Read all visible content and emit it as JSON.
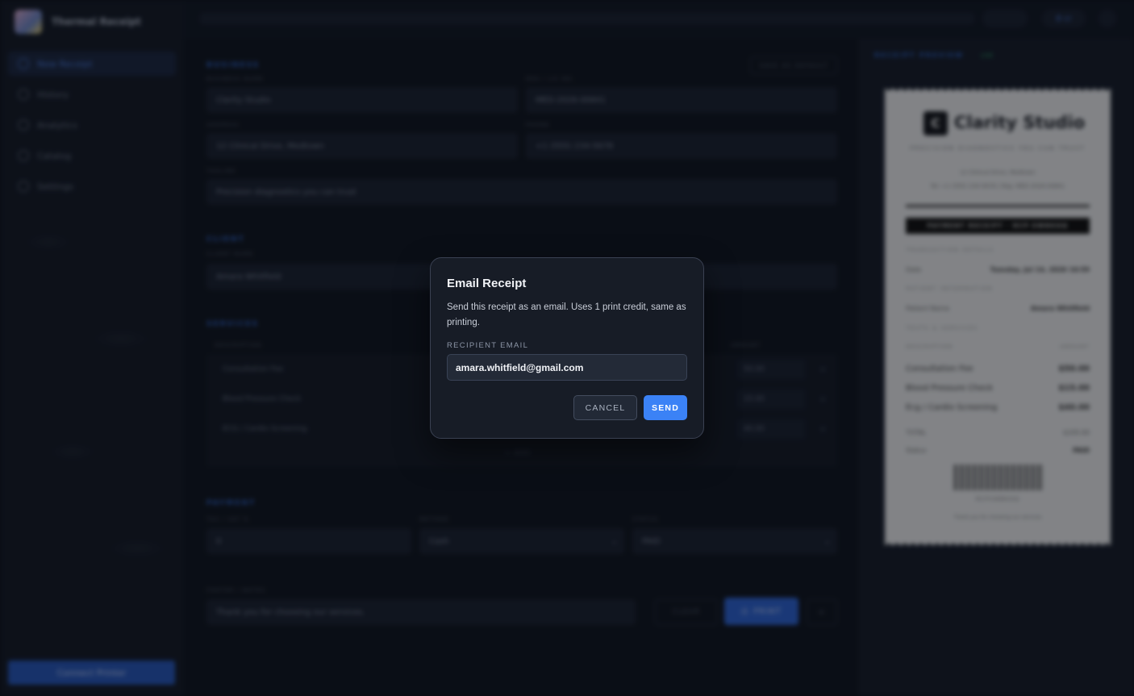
{
  "app": {
    "title": "Thermal Receipt"
  },
  "sidebar": {
    "items": [
      {
        "label": "New Receipt"
      },
      {
        "label": "History"
      },
      {
        "label": "Analytics"
      },
      {
        "label": "Catalog"
      },
      {
        "label": "Settings"
      }
    ],
    "connect_label": "Connect Printer"
  },
  "topbar": {
    "credits": "8 cr"
  },
  "form": {
    "business": {
      "title": "BUSINESS",
      "save_default_label": "SAVE AS DEFAULT",
      "name_label": "BUSINESS NAME",
      "name": "Clarity Studio",
      "reg_label": "REG / LIC NO.",
      "reg": "MED-2026-00841",
      "address_label": "ADDRESS",
      "address": "12 Clinical Drive, Medtown",
      "phone_label": "PHONE",
      "phone": "+1 (555) 234-5678",
      "tagline_label": "TAGLINE",
      "tagline": "Precision diagnostics you can trust"
    },
    "client": {
      "title": "CLIENT",
      "name_label": "CLIENT NAME",
      "name": "Amara Whitfield"
    },
    "services": {
      "title": "SERVICES",
      "desc_header": "DESCRIPTION",
      "amount_header": "AMOUNT",
      "rows": [
        {
          "desc": "Consultation Fee",
          "amount": "50.00"
        },
        {
          "desc": "Blood Pressure Check",
          "amount": "15.00"
        },
        {
          "desc": "ECG / Cardio Screening",
          "amount": "40.00"
        }
      ],
      "add_label": "+ ADD"
    },
    "payment": {
      "title": "PAYMENT",
      "tax_label": "TAX / VAT %",
      "tax": "0",
      "method_label": "METHOD",
      "method": "Cash",
      "status_label": "STATUS",
      "status": "PAID"
    },
    "footer": {
      "label": "FOOTER / NOTES",
      "notes": "Thank you for choosing our services.",
      "clear_label": "CLEAR",
      "print_label": "PRINT"
    }
  },
  "preview": {
    "title": "RECEIPT PREVIEW",
    "badge": "LIVE",
    "receipt": {
      "logo_letter": "C",
      "business_name": "Clarity Studio",
      "tagline": "PRECISION DIAGNOSTICS YOU CAN TRUST",
      "address": "12 Clinical Drive, Medtown",
      "contact": "Tel: +1 (555) 234-5678 | Reg: MED-2026-00841",
      "band": "PAYMENT RECEIPT · RCP-XWBKGQ",
      "txn_header": "TRANSACTION DETAILS",
      "date_label": "Date",
      "date": "Tuesday, Jul 14, 2026 16:59",
      "patient_header": "PATIENT INFORMATION",
      "patient_label": "Patient Name",
      "patient": "Amara Whitfield",
      "tests_header": "TESTS & SERVICES",
      "desc_col": "DESCRIPTION",
      "amount_col": "AMOUNT",
      "items": [
        {
          "desc": "Consultation Fee",
          "amount": "$50.00"
        },
        {
          "desc": "Blood Pressure Check",
          "amount": "$15.00"
        },
        {
          "desc": "Ecg / Cardio Screening",
          "amount": "$40.00"
        }
      ],
      "total_label": "TOTAL",
      "total": "$105.00",
      "status_label": "Status",
      "status": "PAID",
      "barcode_text": "RCPXWBKGQ",
      "thanks": "Thank you for choosing our services"
    }
  },
  "modal": {
    "title": "Email Receipt",
    "description": "Send this receipt as an email. Uses 1 print credit, same as printing.",
    "field_label": "RECIPIENT EMAIL",
    "email_value": "amara.whitfield@gmail.com",
    "cancel_label": "CANCEL",
    "send_label": "SEND"
  },
  "colors": {
    "accent": "#3b82f6",
    "modal_bg": "#171c26",
    "app_bg": "#0d1119"
  }
}
